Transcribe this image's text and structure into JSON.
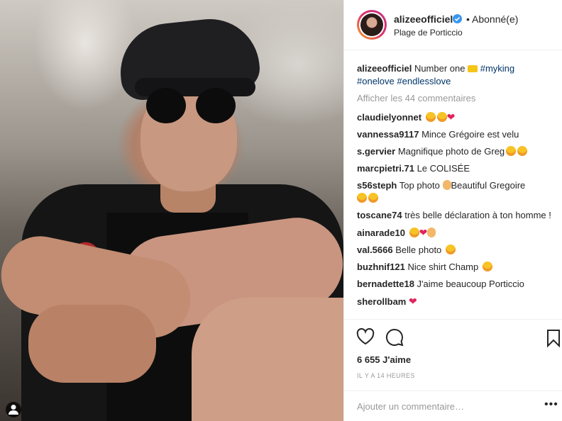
{
  "post": {
    "username": "alizeeofficiel",
    "follow_status": "• Abonné(e)",
    "location": "Plage de Porticcio",
    "caption_user": "alizeeofficiel",
    "caption_text": "Number one",
    "caption_tags": [
      "#myking",
      "#onelove",
      "#endlesslove"
    ],
    "view_all_comments": "Afficher les 44 commentaires"
  },
  "comments": [
    {
      "user": "claudielyonnet",
      "text": "",
      "emojis": [
        "heart-eyes",
        "heart-eyes",
        "red-heart"
      ]
    },
    {
      "user": "vannessa9117",
      "text": "Mince Grégoire est velu",
      "emojis": []
    },
    {
      "user": "s.gervier",
      "text": "Magnifique photo de Greg",
      "emojis": [
        "heart-eyes",
        "heart-eyes"
      ]
    },
    {
      "user": "marcpietri.71",
      "text": "Le COLISÉE",
      "emojis": []
    },
    {
      "user": "s56steph",
      "text": "Top photo",
      "text2": "Beautiful Gregoire",
      "emojis": [
        "ok-hand"
      ],
      "emojis2": [
        "grinning",
        "heart-eyes"
      ]
    },
    {
      "user": "toscane74",
      "text": "très belle déclaration à ton homme !",
      "emojis": []
    },
    {
      "user": "ainarade10",
      "text": "",
      "emojis": [
        "smirk",
        "hearts",
        "clap"
      ]
    },
    {
      "user": "val.5666",
      "text": "Belle photo",
      "emojis": [
        "smirk"
      ]
    },
    {
      "user": "buzhnif121",
      "text": "Nice shirt Champ",
      "emojis": [
        "sunglasses"
      ]
    },
    {
      "user": "bernadette18",
      "text": "J'aime beaucoup Porticcio",
      "emojis": []
    },
    {
      "user": "sherollbam",
      "text": "",
      "emojis": [
        "hearts"
      ]
    }
  ],
  "stats": {
    "likes": "6 655 J'aime",
    "time_ago": "IL Y A 14 HEURES"
  },
  "add_comment": {
    "placeholder": "Ajouter un commentaire…",
    "more": "•••"
  },
  "icons": {
    "like": "heart-outline-icon",
    "comment": "comment-bubble-icon",
    "save": "bookmark-icon",
    "tagged": "user-icon",
    "verified": "verified-badge-icon"
  },
  "colors": {
    "verified": "#3897f0",
    "hashtag": "#003569",
    "muted": "#999999"
  }
}
